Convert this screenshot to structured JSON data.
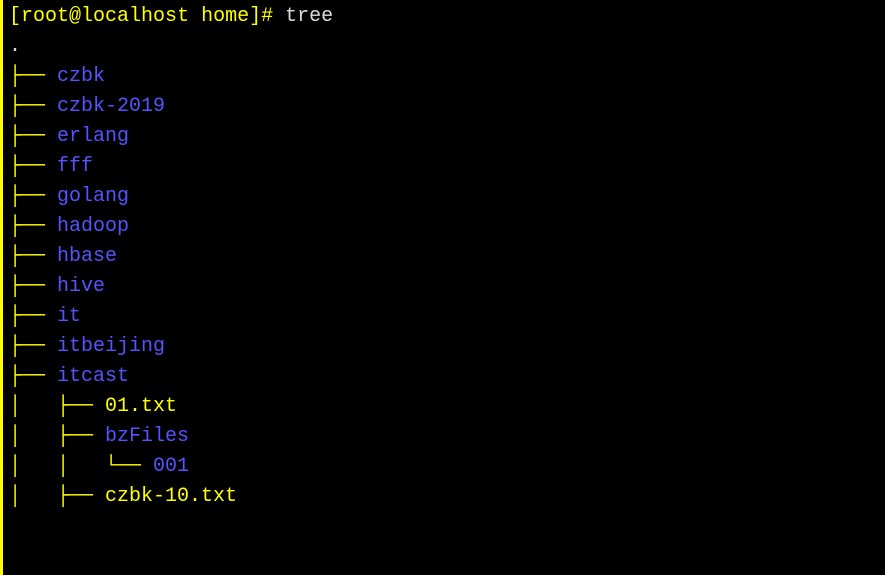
{
  "prompt": {
    "bracket_open": "[",
    "user": "root",
    "at": "@",
    "host": "localhost",
    "space": " ",
    "cwd": "home",
    "bracket_close": "]",
    "symbol": "#",
    "command": " tree"
  },
  "dot": ".",
  "tree": {
    "entries": [
      {
        "prefix": "├── ",
        "name": "czbk",
        "type": "dir"
      },
      {
        "prefix": "├── ",
        "name": "czbk-2019",
        "type": "dir"
      },
      {
        "prefix": "├── ",
        "name": "erlang",
        "type": "dir"
      },
      {
        "prefix": "├── ",
        "name": "fff",
        "type": "dir"
      },
      {
        "prefix": "├── ",
        "name": "golang",
        "type": "dir"
      },
      {
        "prefix": "├── ",
        "name": "hadoop",
        "type": "dir"
      },
      {
        "prefix": "├── ",
        "name": "hbase",
        "type": "dir"
      },
      {
        "prefix": "├── ",
        "name": "hive",
        "type": "dir"
      },
      {
        "prefix": "├── ",
        "name": "it",
        "type": "dir"
      },
      {
        "prefix": "├── ",
        "name": "itbeijing",
        "type": "dir"
      },
      {
        "prefix": "├── ",
        "name": "itcast",
        "type": "dir"
      },
      {
        "prefix": "│   ├── ",
        "name": "01.txt",
        "type": "file"
      },
      {
        "prefix": "│   ├── ",
        "name": "bzFiles",
        "type": "dir"
      },
      {
        "prefix": "│   │   └── ",
        "name": "001",
        "type": "dir"
      },
      {
        "prefix": "│   ├── ",
        "name": "czbk-10.txt",
        "type": "file"
      }
    ]
  }
}
